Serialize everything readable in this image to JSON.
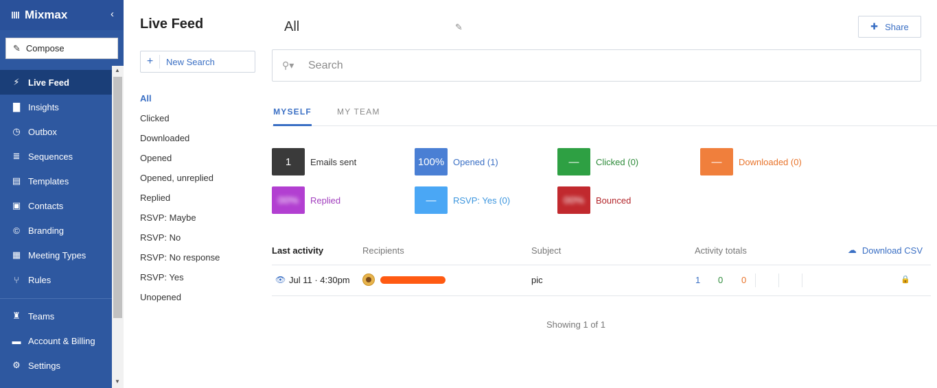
{
  "brand": {
    "logo": "‖‖",
    "name": "Mixmax",
    "collapse": "‹"
  },
  "compose": {
    "label": "Compose"
  },
  "nav": [
    {
      "label": "Live Feed",
      "icon": "⚡",
      "active": true
    },
    {
      "label": "Insights",
      "icon": "▇"
    },
    {
      "label": "Outbox",
      "icon": "◷"
    },
    {
      "label": "Sequences",
      "icon": "≣"
    },
    {
      "label": "Templates",
      "icon": "▤"
    },
    {
      "label": "Contacts",
      "icon": "▣"
    },
    {
      "label": "Branding",
      "icon": "©"
    },
    {
      "label": "Meeting Types",
      "icon": "▦"
    },
    {
      "label": "Rules",
      "icon": "⑂"
    }
  ],
  "nav2": [
    {
      "label": "Teams",
      "icon": "♜"
    },
    {
      "label": "Account & Billing",
      "icon": "▬"
    },
    {
      "label": "Settings",
      "icon": "⚙"
    }
  ],
  "panel": {
    "title": "Live Feed",
    "new_search": "New Search",
    "filters": [
      "All",
      "Clicked",
      "Downloaded",
      "Opened",
      "Opened, unreplied",
      "Replied",
      "RSVP: Maybe",
      "RSVP: No",
      "RSVP: No response",
      "RSVP: Yes",
      "Unopened"
    ]
  },
  "main": {
    "title": "All",
    "share_label": "Share",
    "search_placeholder": "Search",
    "tabs": [
      "MYSELF",
      "MY TEAM"
    ]
  },
  "stats": [
    {
      "value": "1",
      "label": "Emails sent",
      "color": "#3a3a3a",
      "label_color": "#333333"
    },
    {
      "value": "100%",
      "label": "Opened (1)",
      "color": "#4a7fd4",
      "label_color": "#3a6fc4"
    },
    {
      "value": "—",
      "label": "Clicked (0)",
      "color": "#2ea043",
      "label_color": "#2e8b3a"
    },
    {
      "value": "—",
      "label": "Downloaded (0)",
      "color": "#f07f3c",
      "label_color": "#e8732a"
    },
    {
      "value": "00%",
      "label": "Replied",
      "color": "#b23fd1",
      "label_color": "#a13ebe"
    },
    {
      "value": "—",
      "label": "RSVP: Yes (0)",
      "color": "#4aa7f5",
      "label_color": "#3b95de"
    },
    {
      "value": "00%",
      "label": "Bounced",
      "color": "#c1292e",
      "label_color": "#b3262b"
    }
  ],
  "table": {
    "headers": [
      "Last activity",
      "Recipients",
      "Subject",
      "Activity totals"
    ],
    "download": "Download CSV",
    "row": {
      "time": "Jul 11 · 4:30pm",
      "subject": "pic",
      "totals": [
        {
          "value": "1",
          "color": "#3a6fc4"
        },
        {
          "value": "0",
          "color": "#2e8b3a"
        },
        {
          "value": "0",
          "color": "#e8732a"
        }
      ]
    },
    "showing": "Showing 1 of 1"
  }
}
